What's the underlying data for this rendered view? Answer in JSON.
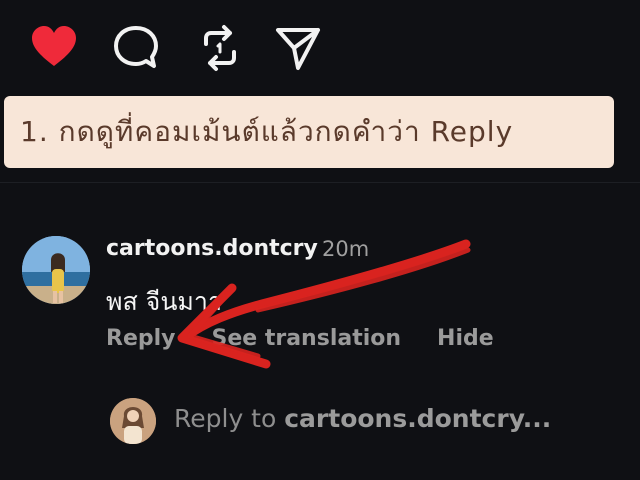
{
  "instruction": {
    "text": "1. กดดูที่คอมเม้นต์แล้วกดคำว่า Reply"
  },
  "actions": [
    {
      "name": "like",
      "icon": "heart-icon"
    },
    {
      "name": "comment",
      "icon": "comment-icon"
    },
    {
      "name": "repost",
      "icon": "repost-icon"
    },
    {
      "name": "share",
      "icon": "send-icon"
    }
  ],
  "comment": {
    "username": "cartoons.dontcry",
    "time": "20m",
    "text": "พส จีนมาา",
    "reply_label": "Reply",
    "translate_label": "See translation",
    "hide_label": "Hide"
  },
  "reply_box": {
    "prefix": "Reply to ",
    "target": "cartoons.dontcry..."
  },
  "colors": {
    "background": "#0f1014",
    "like_red": "#ef2a3a",
    "instruction_bg": "#f8e6d8",
    "arrow_red": "#d9231f"
  }
}
